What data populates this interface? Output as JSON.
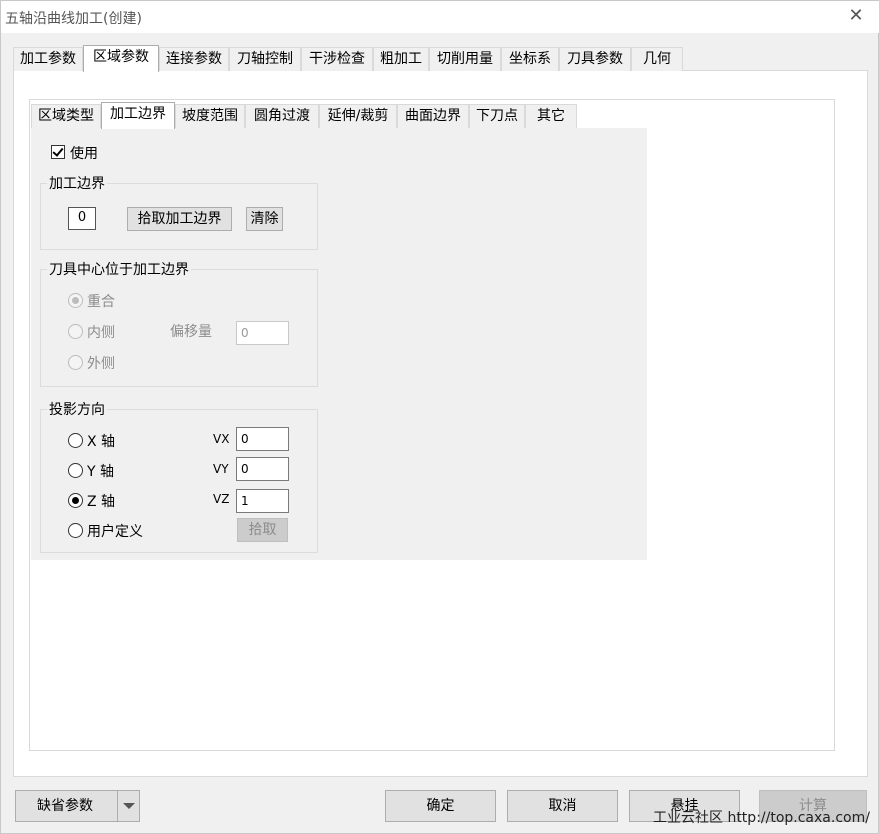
{
  "window": {
    "title": "五轴沿曲线加工(创建)",
    "close_glyph": "✕"
  },
  "main_tabs": [
    {
      "label": "加工参数"
    },
    {
      "label": "区域参数"
    },
    {
      "label": "连接参数"
    },
    {
      "label": "刀轴控制"
    },
    {
      "label": "干涉检查"
    },
    {
      "label": "粗加工"
    },
    {
      "label": "切削用量"
    },
    {
      "label": "坐标系"
    },
    {
      "label": "刀具参数"
    },
    {
      "label": "几何"
    }
  ],
  "sub_tabs": [
    {
      "label": "区域类型"
    },
    {
      "label": "加工边界"
    },
    {
      "label": "坡度范围"
    },
    {
      "label": "圆角过渡"
    },
    {
      "label": "延伸/裁剪"
    },
    {
      "label": "曲面边界"
    },
    {
      "label": "下刀点"
    },
    {
      "label": "其它"
    }
  ],
  "use_checkbox": {
    "label": "使用",
    "checked": true
  },
  "boundary_group": {
    "title": "加工边界",
    "count": "0",
    "pick_label": "拾取加工边界",
    "clear_label": "清除"
  },
  "tool_center_group": {
    "title": "刀具中心位于加工边界",
    "options": [
      "重合",
      "内侧",
      "外侧"
    ],
    "selected": "重合",
    "offset_label": "偏移量",
    "offset_value": "0"
  },
  "projection_group": {
    "title": "投影方向",
    "options": [
      "X 轴",
      "Y 轴",
      "Z 轴",
      "用户定义"
    ],
    "selected": "Z 轴",
    "vx_label": "VX",
    "vy_label": "VY",
    "vz_label": "VZ",
    "vx": "0",
    "vy": "0",
    "vz": "1",
    "pick_label": "拾取"
  },
  "footer": {
    "default_params": "缺省参数",
    "ok": "确定",
    "cancel": "取消",
    "suspend": "悬挂",
    "calc": "计算"
  },
  "watermark": "工业云社区 http://top.caxa.com/"
}
